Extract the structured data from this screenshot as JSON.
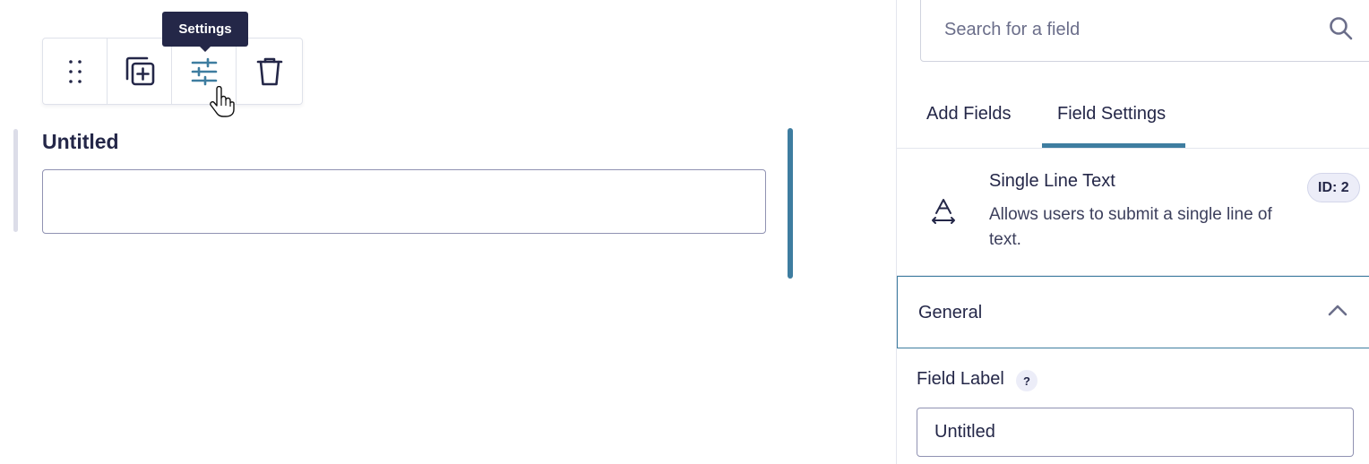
{
  "canvas": {
    "tooltip": "Settings",
    "toolbar": {
      "drag_icon": "drag-handle-icon",
      "duplicate_icon": "duplicate-icon",
      "settings_icon": "sliders-icon",
      "delete_icon": "trash-icon"
    },
    "field": {
      "label": "Untitled",
      "input_value": ""
    }
  },
  "sidebar": {
    "search": {
      "placeholder": "Search for a field",
      "icon": "search-icon"
    },
    "tabs": [
      {
        "label": "Add Fields",
        "active": false
      },
      {
        "label": "Field Settings",
        "active": true
      }
    ],
    "field_info": {
      "icon": "text-type-icon",
      "title": "Single Line Text",
      "description": "Allows users to submit a single line of text.",
      "id_badge": "ID: 2"
    },
    "section": {
      "title": "General",
      "expanded": true,
      "icon": "chevron-up-icon"
    },
    "field_label": {
      "label": "Field Label",
      "help": "?",
      "value": "Untitled"
    }
  },
  "colors": {
    "accent": "#3e7da0",
    "text": "#242748",
    "tooltip_bg": "#242748"
  }
}
